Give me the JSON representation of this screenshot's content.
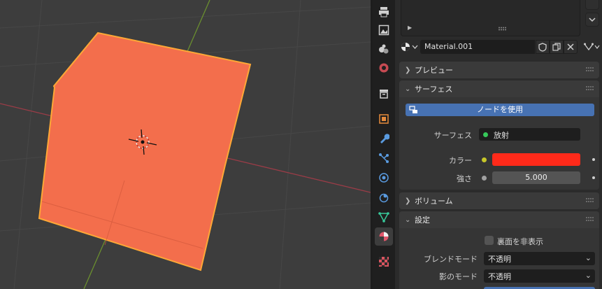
{
  "properties": {
    "material_name": "Material.001",
    "panels": {
      "preview": "プレビュー",
      "surface": "サーフェス",
      "volume": "ボリューム",
      "settings": "設定"
    },
    "surface": {
      "use_nodes_label": "ノードを使用",
      "surface_label": "サーフェス",
      "surface_value": "放射",
      "color_label": "カラー",
      "color_value": "#ff2a1a",
      "strength_label": "強さ",
      "strength_value": "5.000"
    },
    "settings": {
      "backface_label": "裏面を非表示",
      "blend_mode_label": "ブレンドモード",
      "blend_mode_value": "不透明",
      "shadow_mode_label": "影のモード",
      "shadow_mode_value": "不透明"
    }
  },
  "tabs": [
    "render-tab",
    "output-tab",
    "view-layer-tab",
    "scene-tab",
    "world-tab",
    "object-tab",
    "modifier-tab",
    "particles-tab",
    "physics-tab",
    "constraints-tab",
    "data-tab",
    "material-tab",
    "texture-tab"
  ],
  "colors": {
    "accent_blue": "#4772b3",
    "object_orange": "#f36e4c",
    "outline": "#ffa836",
    "viewport_bg": "#3d3d3d"
  }
}
